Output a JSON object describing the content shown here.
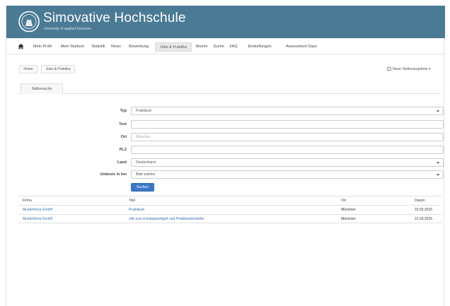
{
  "brand": {
    "title": "Simovative Hochschule",
    "subtitle": "University of applied Sciences",
    "accent": "#4b7a94"
  },
  "nav": {
    "home_icon": "home-icon",
    "items": [
      "Mein Profil",
      "Mein Studium",
      "Statistik",
      "News",
      "Bewerbung",
      "Jobs & Praktika",
      "Alumni",
      "Suche",
      "FAQ",
      "Einstellungen",
      "Assessment Days"
    ],
    "active_index": 5
  },
  "breadcrumb": [
    "Home",
    "Jobs & Praktika"
  ],
  "rss_link": "Neue Stellenangebote",
  "tab": "Stellensuche",
  "form": {
    "labels": {
      "typ": "Typ",
      "text": "Text",
      "ort": "Ort",
      "plz": "PLZ",
      "land": "Land",
      "umkreis": "Umkreis in km"
    },
    "values": {
      "typ": "Praktikum",
      "text": "",
      "ort": "München",
      "plz": "",
      "land": "Deutschland",
      "umkreis": "Bitte wählen"
    },
    "search_button": "Suchen",
    "button_color": "#3a78c6"
  },
  "table": {
    "headers": [
      "Firma",
      "Titel",
      "Ort",
      "Datum"
    ],
    "rows": [
      [
        "Musterfirma GmbH",
        "Praktikum",
        "München",
        "15.03.2015"
      ],
      [
        "Musterfirma GmbH",
        "Job zum Einstiegsentgelt und Praktikantenstelle",
        "München",
        "21.03.2015"
      ]
    ]
  }
}
